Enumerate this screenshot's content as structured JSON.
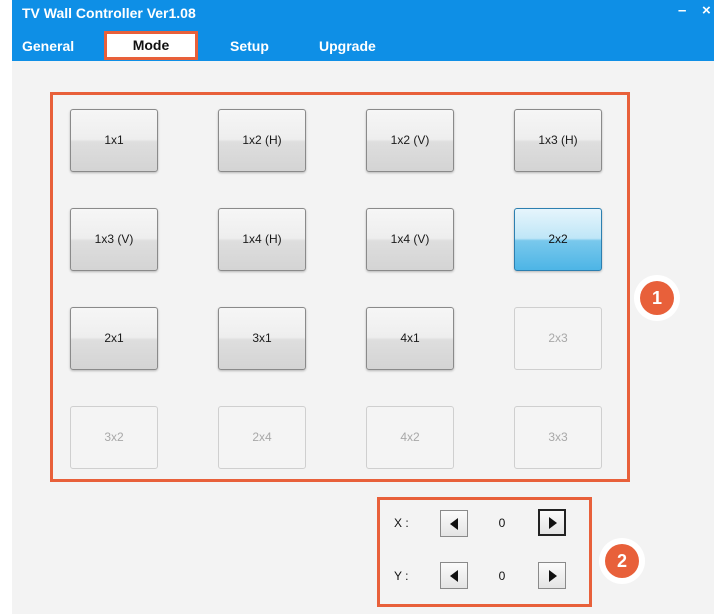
{
  "window": {
    "title": "TV Wall Controller Ver1.08",
    "minimize_glyph": "–",
    "close_glyph": "×"
  },
  "tabs": [
    {
      "label": "General"
    },
    {
      "label": "Mode",
      "active": true
    },
    {
      "label": "Setup"
    },
    {
      "label": "Upgrade"
    }
  ],
  "modes": [
    {
      "label": "1x1",
      "state": "normal"
    },
    {
      "label": "1x2 (H)",
      "state": "normal"
    },
    {
      "label": "1x2 (V)",
      "state": "normal"
    },
    {
      "label": "1x3 (H)",
      "state": "normal"
    },
    {
      "label": "1x3 (V)",
      "state": "normal"
    },
    {
      "label": "1x4 (H)",
      "state": "normal"
    },
    {
      "label": "1x4 (V)",
      "state": "normal"
    },
    {
      "label": "2x2",
      "state": "selected"
    },
    {
      "label": "2x1",
      "state": "normal"
    },
    {
      "label": "3x1",
      "state": "normal"
    },
    {
      "label": "4x1",
      "state": "normal"
    },
    {
      "label": "2x3",
      "state": "disabled"
    },
    {
      "label": "3x2",
      "state": "disabled"
    },
    {
      "label": "2x4",
      "state": "disabled"
    },
    {
      "label": "4x2",
      "state": "disabled"
    },
    {
      "label": "3x3",
      "state": "disabled"
    }
  ],
  "position": {
    "x_label": "X :",
    "x_value": "0",
    "y_label": "Y :",
    "y_value": "0"
  },
  "callouts": {
    "badge1": "1",
    "badge2": "2"
  },
  "colors": {
    "titlebar": "#0e8fe6",
    "highlight": "#e8603a",
    "selected_mode": "#4db5e6"
  }
}
